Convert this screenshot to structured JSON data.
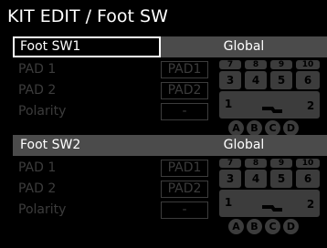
{
  "screen": {
    "title": "KIT EDIT / Foot SW"
  },
  "sections": [
    {
      "name": "Foot SW1",
      "mode": "Global",
      "selected": true,
      "rows": [
        {
          "label": "PAD 1",
          "value": "PAD1"
        },
        {
          "label": "PAD 2",
          "value": "PAD2"
        },
        {
          "label": "Polarity",
          "value": "-"
        }
      ]
    },
    {
      "name": "Foot SW2",
      "mode": "Global",
      "selected": false,
      "rows": [
        {
          "label": "PAD 1",
          "value": "PAD1"
        },
        {
          "label": "PAD 2",
          "value": "PAD2"
        },
        {
          "label": "Polarity",
          "value": "-"
        }
      ]
    }
  ],
  "pad_diagram": {
    "top_row": [
      "7",
      "8",
      "9",
      "10"
    ],
    "middle_row": [
      "3",
      "4",
      "5",
      "6"
    ],
    "bottom_left": "1",
    "bottom_right": "2",
    "circles": [
      "A",
      "B",
      "C",
      "D"
    ]
  },
  "colors": {
    "background": "#000000",
    "text": "#ffffff",
    "dim": "#3c3c3c",
    "header_fill": "#4b4b4b"
  },
  "icons": {
    "pedal": "foot-pedal-icon"
  }
}
